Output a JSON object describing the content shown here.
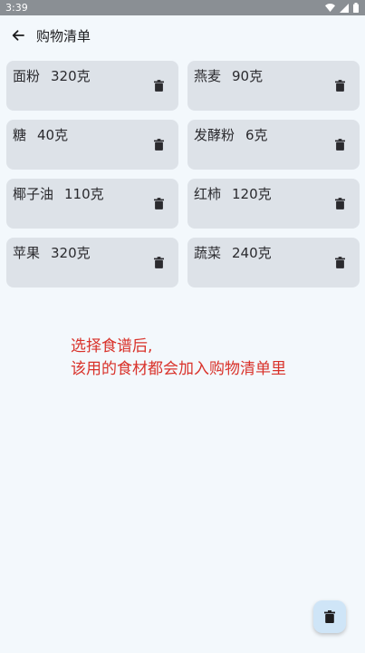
{
  "status_bar": {
    "time": "3:39",
    "icons": [
      "wifi-icon",
      "signal-icon",
      "battery-icon"
    ]
  },
  "app_bar": {
    "back_icon": "arrow-left-icon",
    "title": "购物清单"
  },
  "items": [
    {
      "name": "面粉",
      "amount": "320克"
    },
    {
      "name": "燕麦",
      "amount": "90克"
    },
    {
      "name": "糖",
      "amount": "40克"
    },
    {
      "name": "发酵粉",
      "amount": "6克"
    },
    {
      "name": "椰子油",
      "amount": "110克"
    },
    {
      "name": "红柿",
      "amount": "120克"
    },
    {
      "name": "苹果",
      "amount": "320克"
    },
    {
      "name": "蔬菜",
      "amount": "240克"
    }
  ],
  "annotation": {
    "line1": "选择食谱后,",
    "line2": "该用的食材都会加入购物清单里"
  },
  "fab": {
    "icon": "trash-icon"
  },
  "colors": {
    "background": "#f3f8fc",
    "card": "#dde2e8",
    "fab": "#cfe5f7",
    "annotation": "#d9322a",
    "status_bar": "#8a8f94"
  }
}
